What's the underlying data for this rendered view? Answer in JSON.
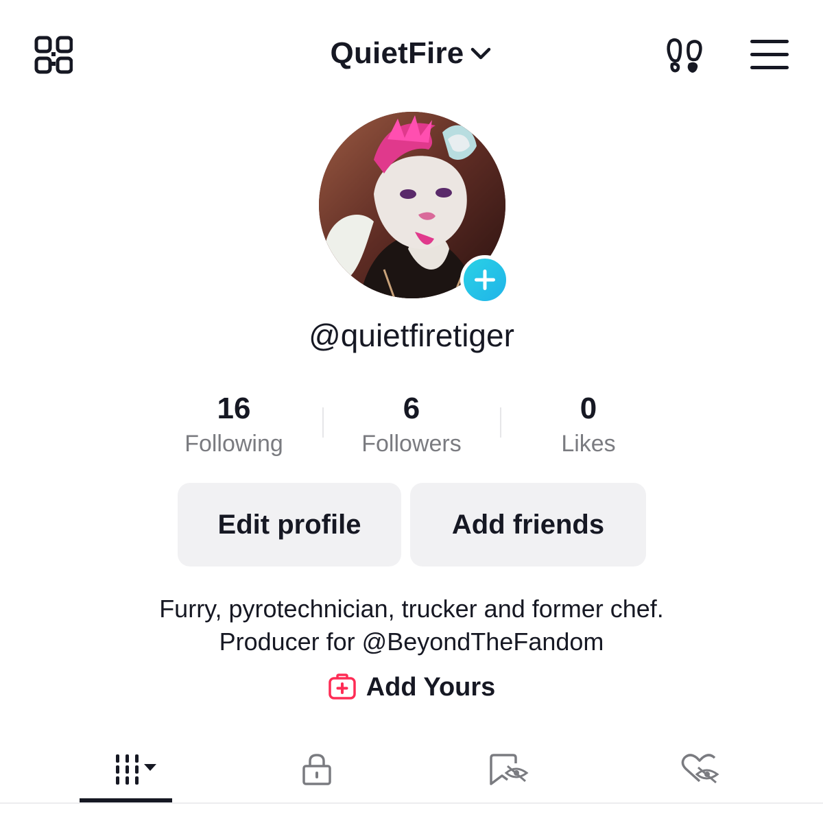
{
  "header": {
    "username": "QuietFire",
    "icons": {
      "qr": "qr-code-icon",
      "dropdown": "chevron-down-icon",
      "footprint": "footprint-icon",
      "menu": "hamburger-menu-icon"
    }
  },
  "profile": {
    "handle": "@quietfiretiger",
    "add_avatar_icon": "plus-icon",
    "accent_color": "#20b4e8"
  },
  "stats": [
    {
      "value": "16",
      "label": "Following"
    },
    {
      "value": "6",
      "label": "Followers"
    },
    {
      "value": "0",
      "label": "Likes"
    }
  ],
  "actions": {
    "edit_profile": "Edit profile",
    "add_friends": "Add friends"
  },
  "bio": {
    "line1": "Furry, pyrotechnician, trucker and former chef.",
    "line2": "Producer for @BeyondTheFandom"
  },
  "add_yours": {
    "label": "Add Yours",
    "icon": "add-yours-icon",
    "icon_color": "#fe2c55"
  },
  "tabs": [
    {
      "name": "videos",
      "icon": "grid-videos-icon",
      "active": true
    },
    {
      "name": "private",
      "icon": "lock-icon",
      "active": false
    },
    {
      "name": "saved",
      "icon": "hidden-bookmark-icon",
      "active": false
    },
    {
      "name": "liked",
      "icon": "hidden-heart-icon",
      "active": false
    }
  ]
}
